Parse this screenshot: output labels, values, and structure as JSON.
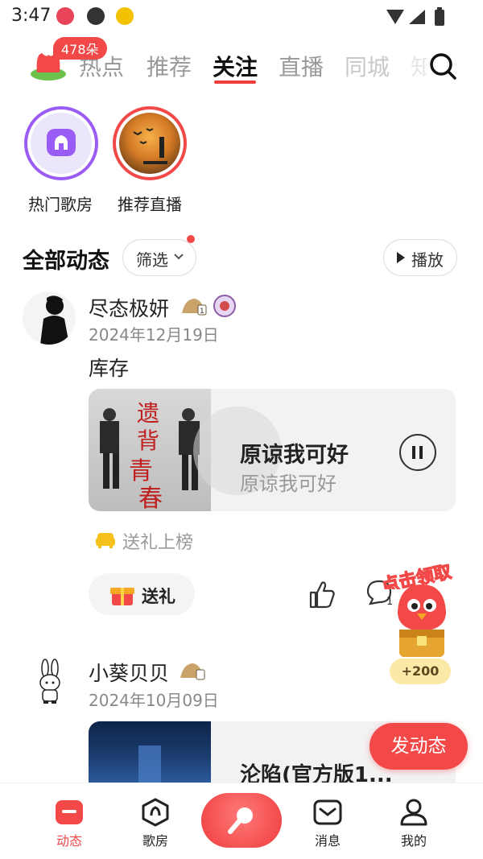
{
  "status_bar": {
    "time": "3:47"
  },
  "tabs": {
    "flower_badge": "478朵",
    "items": [
      "热点",
      "推荐",
      "关注",
      "直播",
      "同城",
      "知"
    ],
    "active_index": 2
  },
  "stories": [
    {
      "label": "热门歌房"
    },
    {
      "label": "推荐直播"
    }
  ],
  "feed_header": {
    "title": "全部动态",
    "filter_label": "筛选",
    "play_label": "播放"
  },
  "posts": [
    {
      "user_name": "尽态极妍",
      "level": "1",
      "date": "2024年12月19日",
      "text": "库存",
      "song": {
        "title": "原谅我可好",
        "subtitle": "原谅我可好"
      },
      "cover_text": "遗背的青春",
      "gift_rank": "送礼上榜",
      "gift_button": "送礼",
      "comment_count": "1"
    },
    {
      "user_name": "小葵贝贝",
      "date": "2024年10月09日",
      "song": {
        "title": "沦陷(官方版1..."
      }
    }
  ],
  "floating": {
    "reward_text": "点击领取",
    "reward_amount": "+200",
    "post_button": "发动态"
  },
  "bottom_nav": [
    {
      "label": "动态",
      "icon": "dynamic-icon",
      "active": true
    },
    {
      "label": "歌房",
      "icon": "song-room-icon",
      "active": false
    },
    {
      "label": "",
      "icon": "microphone-icon",
      "active": false
    },
    {
      "label": "消息",
      "icon": "message-icon",
      "active": false
    },
    {
      "label": "我的",
      "icon": "profile-icon",
      "active": false
    }
  ],
  "colors": {
    "accent": "#f24848",
    "purple": "#9b5cf6"
  }
}
